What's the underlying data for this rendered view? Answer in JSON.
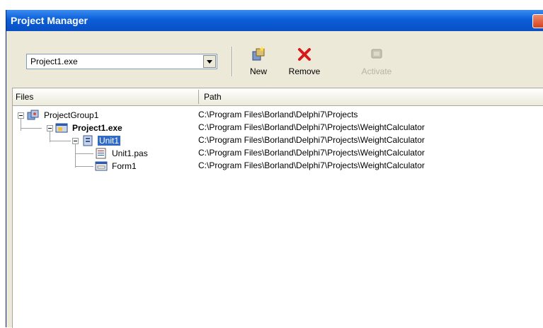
{
  "window": {
    "title": "Project Manager"
  },
  "toolbar": {
    "project_combo_value": "Project1.exe",
    "new_label": "New",
    "remove_label": "Remove",
    "activate_label": "Activate"
  },
  "columns": {
    "files": "Files",
    "path": "Path"
  },
  "tree": [
    {
      "name": "ProjectGroup1",
      "path": "C:\\Program Files\\Borland\\Delphi7\\Projects"
    },
    {
      "name": "Project1.exe",
      "path": "C:\\Program Files\\Borland\\Delphi7\\Projects\\WeightCalculator"
    },
    {
      "name": "Unit1",
      "path": "C:\\Program Files\\Borland\\Delphi7\\Projects\\WeightCalculator"
    },
    {
      "name": "Unit1.pas",
      "path": "C:\\Program Files\\Borland\\Delphi7\\Projects\\WeightCalculator"
    },
    {
      "name": "Form1",
      "path": "C:\\Program Files\\Borland\\Delphi7\\Projects\\WeightCalculator"
    }
  ],
  "colors": {
    "title_bar": "#0b5fd8",
    "selection": "#316ac5",
    "window_bg": "#ece9d8"
  }
}
